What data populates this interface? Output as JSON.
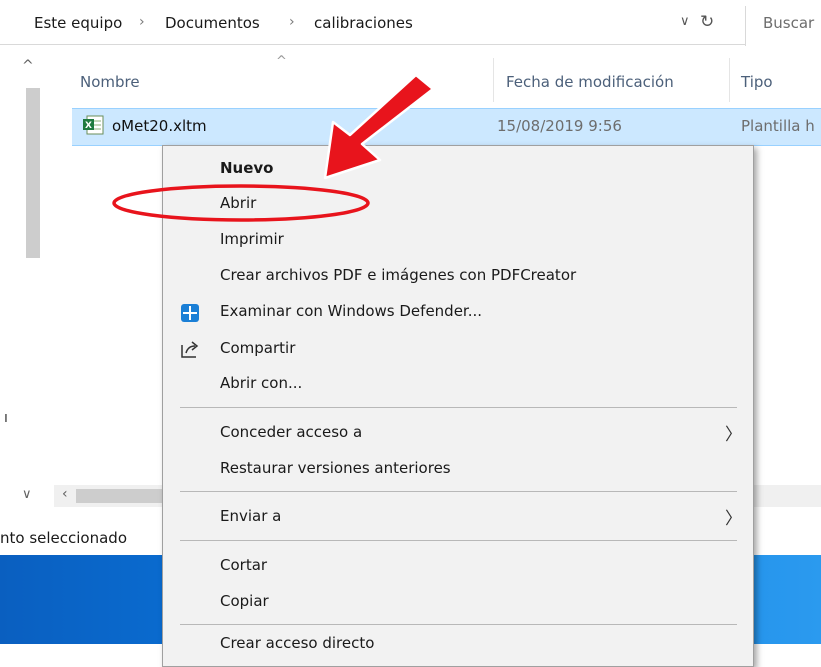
{
  "breadcrumb": {
    "items": [
      "Este equipo",
      "Documentos",
      "calibraciones"
    ],
    "separator": "›"
  },
  "address": {
    "dropdown_glyph": "∨",
    "refresh_glyph": "↻"
  },
  "search": {
    "placeholder": "Buscar"
  },
  "columns": {
    "name": "Nombre",
    "date": "Fecha de modificación",
    "type": "Tipo"
  },
  "file": {
    "icon": "excel-template-icon",
    "name": "oMet20.xltm",
    "date": "15/08/2019 9:56",
    "type": "Plantilla h"
  },
  "status": {
    "text": "nto seleccionado"
  },
  "context_menu": {
    "items": [
      {
        "label": "Nuevo",
        "bold": true
      },
      {
        "label": "Abrir"
      },
      {
        "label": "Imprimir"
      },
      {
        "label": "Crear archivos PDF e imágenes con PDFCreator"
      },
      {
        "label": "Examinar con Windows Defender...",
        "icon": "windows-defender-icon"
      },
      {
        "label": "Compartir",
        "icon": "share-icon"
      },
      {
        "label": "Abrir con..."
      },
      {
        "label": "Conceder acceso a",
        "submenu": true
      },
      {
        "label": "Restaurar versiones anteriores"
      },
      {
        "label": "Enviar a",
        "submenu": true
      },
      {
        "label": "Cortar"
      },
      {
        "label": "Copiar"
      },
      {
        "label": "Crear acceso directo"
      }
    ]
  },
  "colors": {
    "selection": "#cce8ff",
    "annotation_red": "#e8141c",
    "desktop_blue": "#0a73d9"
  }
}
